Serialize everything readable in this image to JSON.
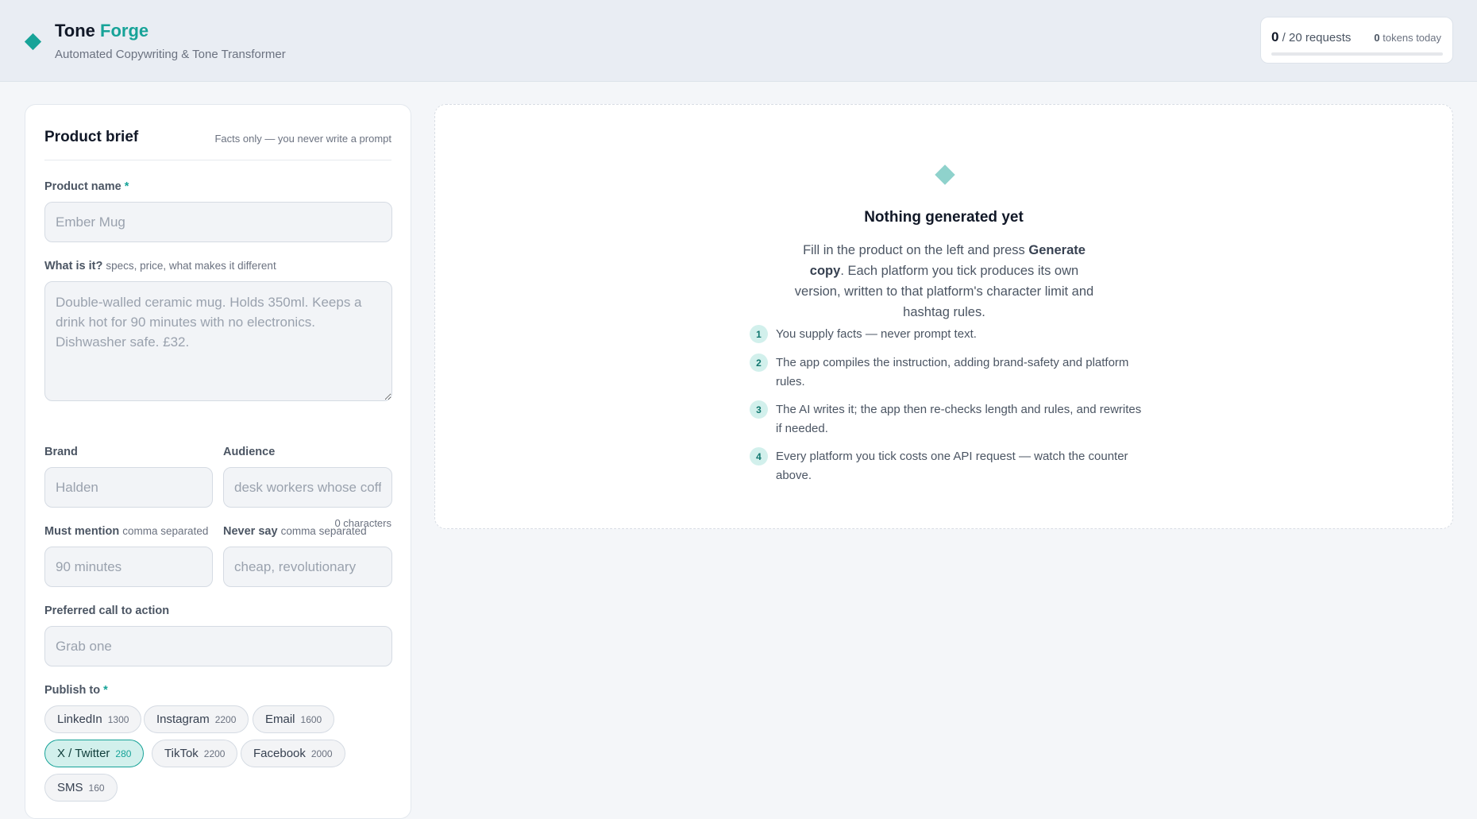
{
  "header": {
    "title_part1": "Tone",
    "title_part2": "Forge",
    "subtitle": "Automated Copywriting & Tone Transformer",
    "brand_color": "#17a398",
    "usage": {
      "requests_used": "0",
      "requests_total": "/ 20 requests",
      "tokens": "0",
      "tokens_label": "tokens today",
      "progress_fraction": 0
    }
  },
  "brief": {
    "title": "Product brief",
    "note": "Facts only — you never write a prompt",
    "product_name": {
      "label": "Product name",
      "required": "*",
      "value": "",
      "placeholder": "Ember Mug"
    },
    "what": {
      "label": "What is it?",
      "hint": "specs, price, what makes it different",
      "value": "",
      "placeholder": "Double-walled ceramic mug. Holds 350ml. Keeps a drink hot for 90 minutes with no electronics. Dishwasher safe. £32.",
      "char_count": "0 characters"
    },
    "brand": {
      "label": "Brand",
      "value": "",
      "placeholder": "Halden"
    },
    "audience": {
      "label": "Audience",
      "value": "",
      "placeholder": "desk workers whose coffee goes cold"
    },
    "must_mention": {
      "label": "Must mention",
      "hint": "comma separated",
      "value": "",
      "placeholder": "90 minutes"
    },
    "never_say": {
      "label": "Never say",
      "hint": "comma separated",
      "value": "",
      "placeholder": "cheap, revolutionary"
    },
    "cta": {
      "label": "Preferred call to action",
      "value": "",
      "placeholder": "Grab one"
    },
    "publish": {
      "label": "Publish to",
      "required": "*",
      "platforms": [
        {
          "name": "LinkedIn",
          "limit": "1300",
          "selected": false
        },
        {
          "name": "Instagram",
          "limit": "2200",
          "selected": false
        },
        {
          "name": "Email",
          "limit": "1600",
          "selected": false
        },
        {
          "name": "X / Twitter",
          "limit": "280",
          "selected": true
        },
        {
          "name": "TikTok",
          "limit": "2200",
          "selected": false
        },
        {
          "name": "Facebook",
          "limit": "2000",
          "selected": false
        },
        {
          "name": "SMS",
          "limit": "160",
          "selected": false
        }
      ]
    }
  },
  "empty_state": {
    "title": "Nothing generated yet",
    "desc_before": "Fill in the product on the left and press ",
    "desc_bold": "Generate copy",
    "desc_after": ". Each platform you tick produces its own version, written to that platform's character limit and hashtag rules.",
    "steps": [
      {
        "num": "1",
        "text": "You supply facts — never prompt text."
      },
      {
        "num": "2",
        "text": "The app compiles the instruction, adding brand-safety and platform rules."
      },
      {
        "num": "3",
        "text": "The AI writes it; the app then re-checks length and rules, and rewrites if needed."
      },
      {
        "num": "4",
        "text": "Every platform you tick costs one API request — watch the counter above."
      }
    ]
  }
}
